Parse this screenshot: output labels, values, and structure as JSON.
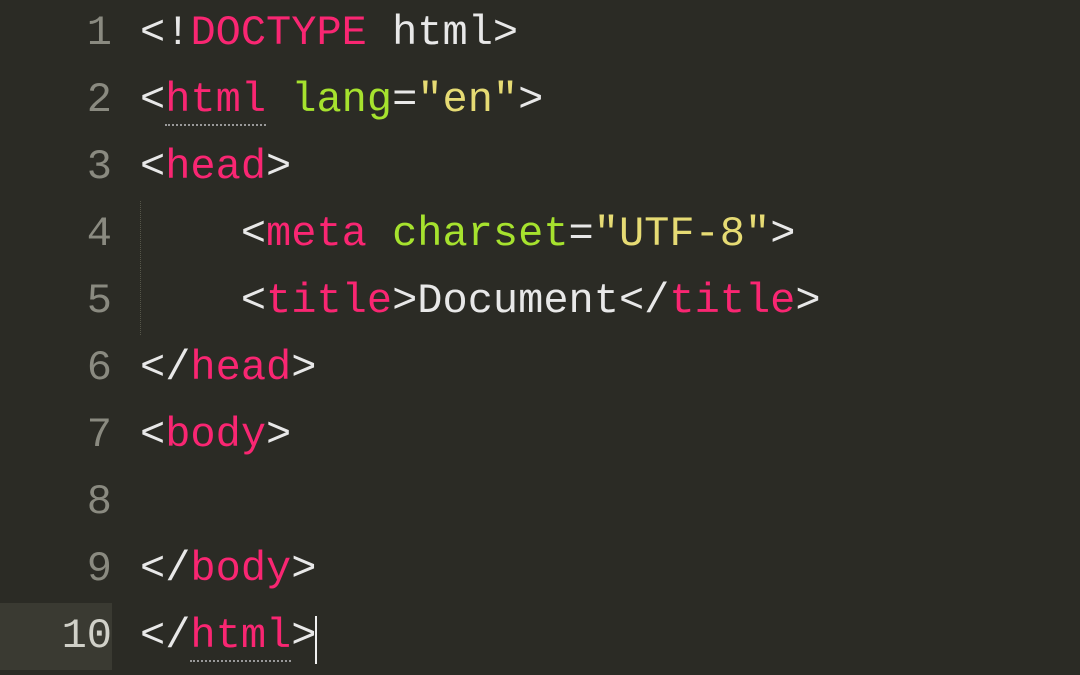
{
  "gutter": {
    "lines": [
      "1",
      "2",
      "3",
      "4",
      "5",
      "6",
      "7",
      "8",
      "9",
      "10"
    ],
    "activeLine": 10
  },
  "tokens": {
    "lt": "<",
    "gt": ">",
    "lts": "</",
    "bang": "!",
    "eq": "=",
    "sp": " ",
    "indent": "    "
  },
  "code": {
    "doctype_kw": "DOCTYPE",
    "doctype_val": "html",
    "html_tag": "html",
    "lang_attr": "lang",
    "lang_val": "\"en\"",
    "head_tag": "head",
    "meta_tag": "meta",
    "charset_attr": "charset",
    "charset_val": "\"UTF-8\"",
    "title_tag": "title",
    "title_text": "Document",
    "body_tag": "body"
  }
}
